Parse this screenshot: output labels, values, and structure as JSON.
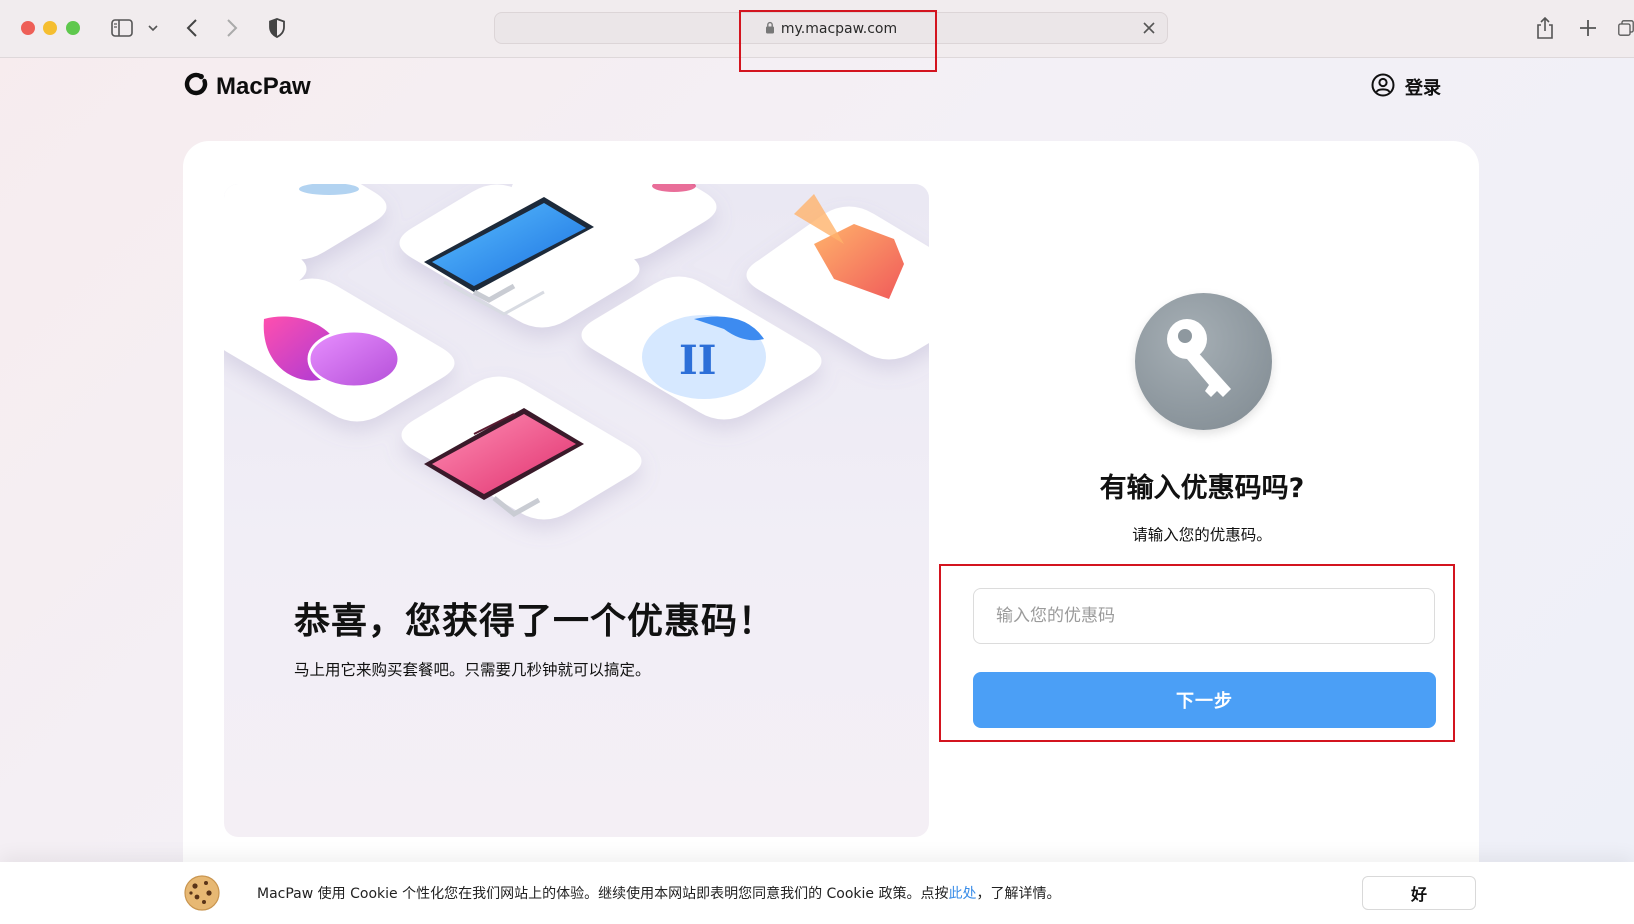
{
  "browser": {
    "url": "my.macpaw.com"
  },
  "header": {
    "logo_text": "MacPaw",
    "login_label": "登录"
  },
  "promo": {
    "title": "恭喜，您获得了一个优惠码！",
    "subtitle": "马上用它来购买套餐吧。只需要几秒钟就可以搞定。"
  },
  "coupon": {
    "title": "有输入优惠码吗?",
    "subtitle": "请输入您的优惠码。",
    "input_placeholder": "输入您的优惠码",
    "input_value": "",
    "next_label": "下一步"
  },
  "cookie": {
    "text_before": "MacPaw 使用 Cookie 个性化您在我们网站上的体验。继续使用本网站即表明您同意我们的 Cookie 政策。点按",
    "link_text": "此处",
    "text_after": "，了解详情。",
    "ok_label": "好"
  },
  "colors": {
    "primary_button": "#4b9ff6",
    "highlight_box": "#d3141f",
    "link": "#3a8de8"
  },
  "icons": [
    "sidebar-icon",
    "chevron-down-icon",
    "back-arrow-icon",
    "forward-arrow-icon",
    "shield-icon",
    "lock-icon",
    "close-icon",
    "share-icon",
    "plus-icon",
    "tabs-icon",
    "user-circle-icon",
    "key-icon",
    "cookie-icon"
  ]
}
